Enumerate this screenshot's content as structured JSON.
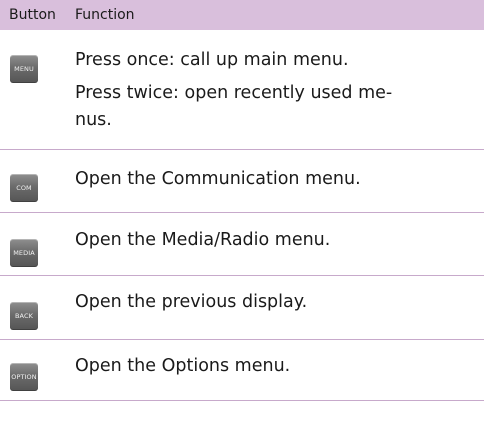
{
  "table": {
    "header": {
      "button": "Button",
      "function": "Function"
    },
    "rows": [
      {
        "key": "MENU",
        "lines": [
          "Press once: call up main menu.",
          "Press twice: open recently used me-",
          "nus."
        ]
      },
      {
        "key": "COM",
        "lines": [
          "Open the Communication menu."
        ]
      },
      {
        "key": "MEDIA",
        "lines": [
          "Open the Media/Radio menu."
        ]
      },
      {
        "key": "BACK",
        "lines": [
          "Open the previous display."
        ]
      },
      {
        "key": "OPTION",
        "lines": [
          "Open the Options menu."
        ]
      }
    ]
  },
  "colors": {
    "header_bg": "#d9bfdc",
    "row_divider": "#c7a9cb",
    "key_bg": "#6b6b6b"
  }
}
